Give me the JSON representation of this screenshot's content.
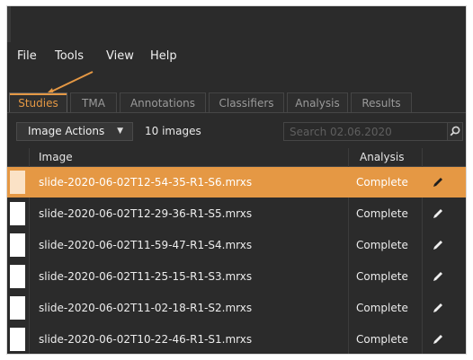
{
  "menu": [
    "File",
    "Tools",
    "View",
    "Help"
  ],
  "tabs": [
    {
      "label": "Studies",
      "active": true
    },
    {
      "label": "TMA",
      "active": false
    },
    {
      "label": "Annotations",
      "active": false
    },
    {
      "label": "Classifiers",
      "active": false
    },
    {
      "label": "Analysis",
      "active": false
    },
    {
      "label": "Results",
      "active": false
    }
  ],
  "toolbar": {
    "actions_label": "Image Actions",
    "image_count": "10 images",
    "search_placeholder": "Search 02.06.2020"
  },
  "table": {
    "headers": {
      "image": "Image",
      "analysis": "Analysis"
    },
    "rows": [
      {
        "name": "slide-2020-06-02T12-54-35-R1-S6.mrxs",
        "status": "Complete",
        "selected": true
      },
      {
        "name": "slide-2020-06-02T12-29-36-R1-S5.mrxs",
        "status": "Complete",
        "selected": false
      },
      {
        "name": "slide-2020-06-02T11-59-47-R1-S4.mrxs",
        "status": "Complete",
        "selected": false
      },
      {
        "name": "slide-2020-06-02T11-25-15-R1-S3.mrxs",
        "status": "Complete",
        "selected": false
      },
      {
        "name": "slide-2020-06-02T11-02-18-R1-S2.mrxs",
        "status": "Complete",
        "selected": false
      },
      {
        "name": "slide-2020-06-02T10-22-46-R1-S1.mrxs",
        "status": "Complete",
        "selected": false
      }
    ]
  },
  "colors": {
    "accent": "#e59844",
    "background": "#2b2b2b",
    "annotation_arrow": "#e59844"
  },
  "icons": {
    "search": "search-icon",
    "edit": "pencil-icon",
    "dropdown": "chevron-down-icon"
  }
}
